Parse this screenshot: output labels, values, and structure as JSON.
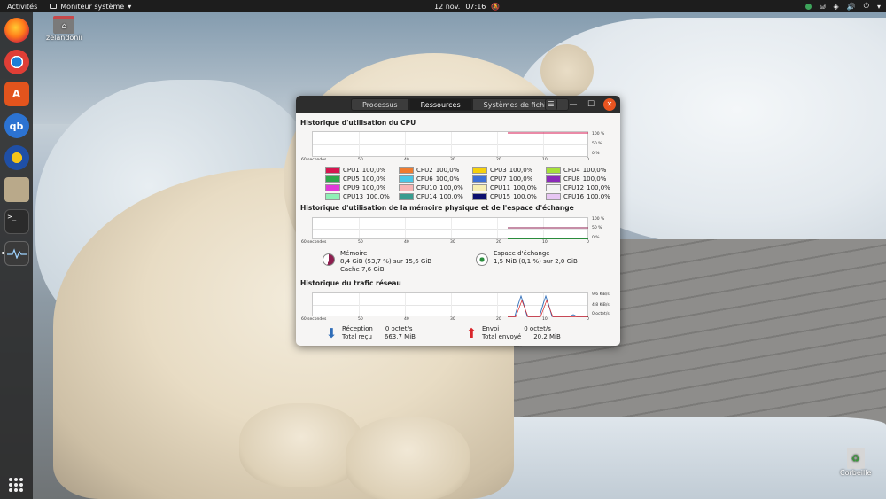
{
  "topbar": {
    "activities": "Activités",
    "app_menu": "Moniteur système",
    "date": "12 nov.",
    "time": "07:16"
  },
  "desktop": {
    "home_label": "zelandonii",
    "trash_label": "Corbeille"
  },
  "window": {
    "tabs": [
      "Processus",
      "Ressources",
      "Systèmes de fichiers"
    ],
    "active_tab": "Ressources",
    "cpu": {
      "title": "Historique d'utilisation du CPU",
      "x_ticks": [
        "60 secondes",
        "50",
        "40",
        "30",
        "20",
        "10",
        "0"
      ],
      "y_ticks": [
        "100 %",
        "50 %",
        "0 %"
      ],
      "cores": [
        {
          "label": "CPU1",
          "value": "100,0%",
          "color": "#d6154f"
        },
        {
          "label": "CPU2",
          "value": "100,0%",
          "color": "#ef7b2f"
        },
        {
          "label": "CPU3",
          "value": "100,0%",
          "color": "#f6d10c"
        },
        {
          "label": "CPU4",
          "value": "100,0%",
          "color": "#a7e03a"
        },
        {
          "label": "CPU5",
          "value": "100,0%",
          "color": "#2da84a"
        },
        {
          "label": "CPU6",
          "value": "100,0%",
          "color": "#4bc7e6"
        },
        {
          "label": "CPU7",
          "value": "100,0%",
          "color": "#3e6fd6"
        },
        {
          "label": "CPU8",
          "value": "100,0%",
          "color": "#8a2bb8"
        },
        {
          "label": "CPU9",
          "value": "100,0%",
          "color": "#e13ad8"
        },
        {
          "label": "CPU10",
          "value": "100,0%",
          "color": "#f7b4b4"
        },
        {
          "label": "CPU11",
          "value": "100,0%",
          "color": "#f7eeb2"
        },
        {
          "label": "CPU12",
          "value": "100,0%",
          "color": "#f3f3f3"
        },
        {
          "label": "CPU13",
          "value": "100,0%",
          "color": "#8ff0b6"
        },
        {
          "label": "CPU14",
          "value": "100,0%",
          "color": "#3a9c8f"
        },
        {
          "label": "CPU15",
          "value": "100,0%",
          "color": "#0b0f6e"
        },
        {
          "label": "CPU16",
          "value": "100,0%",
          "color": "#e7c6f3"
        }
      ]
    },
    "memory": {
      "title": "Historique d'utilisation de la mémoire physique et de l'espace d'échange",
      "x_ticks": [
        "60 secondes",
        "50",
        "40",
        "30",
        "20",
        "10",
        "0"
      ],
      "y_ticks": [
        "100 %",
        "50 %",
        "0 %"
      ],
      "mem_label": "Mémoire",
      "mem_usage": "8,4 GiB (53,7 %) sur 15,6 GiB",
      "mem_cache": "Cache 7,6 GiB",
      "mem_color": "#8e1e4f",
      "swap_label": "Espace d'échange",
      "swap_usage": "1,5 MiB (0,1 %) sur 2,0 GiB",
      "swap_color": "#2a8c3c"
    },
    "network": {
      "title": "Historique du trafic réseau",
      "x_ticks": [
        "60 secondes",
        "50",
        "40",
        "30",
        "20",
        "10",
        "0"
      ],
      "y_ticks": [
        "9,6 KiB/s",
        "4,8 KiB/s",
        "0 octet/s"
      ],
      "rx_label": "Réception",
      "rx_rate": "0 octet/s",
      "rx_total_label": "Total reçu",
      "rx_total": "663,7 MiB",
      "tx_label": "Envoi",
      "tx_rate": "0 octet/s",
      "tx_total_label": "Total envoyé",
      "tx_total": "20,2 MiB",
      "rx_color": "#2f6db8",
      "tx_color": "#d9262b"
    }
  }
}
